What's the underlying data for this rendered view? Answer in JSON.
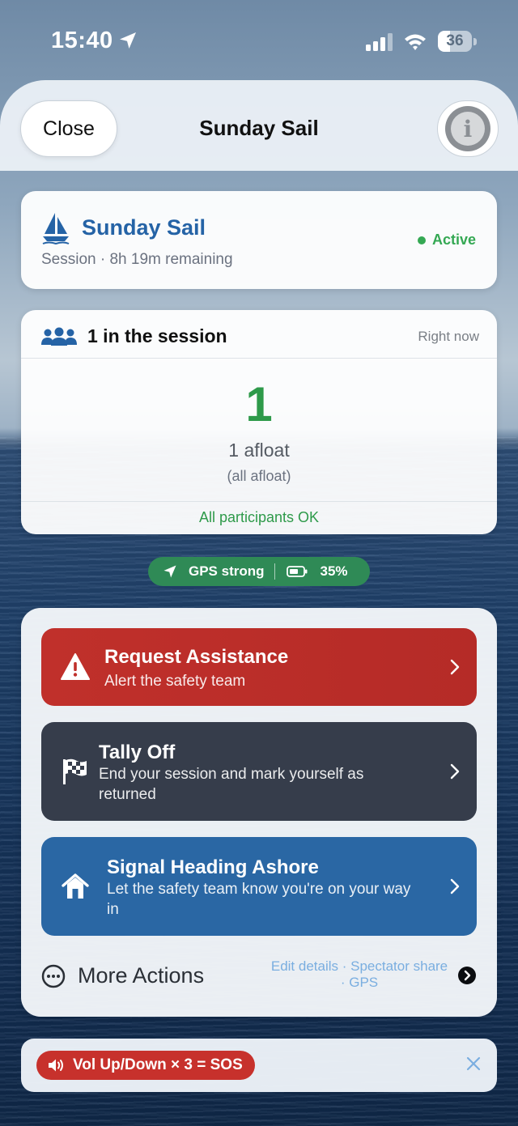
{
  "status_bar": {
    "time": "15:40",
    "battery_level": "36"
  },
  "header": {
    "close_label": "Close",
    "title": "Sunday Sail",
    "info_glyph": "i"
  },
  "session": {
    "name": "Sunday Sail",
    "subtitle": "Session · 8h 19m remaining",
    "status": "Active"
  },
  "participants": {
    "title": "1 in the session",
    "updated": "Right now",
    "count": "1",
    "afloat_label": "1 afloat",
    "afloat_sub": "(all afloat)",
    "status_ok": "All participants OK"
  },
  "gps": {
    "label": "GPS strong",
    "battery": "35%"
  },
  "actions": {
    "assist": {
      "title": "Request Assistance",
      "subtitle": "Alert the safety team",
      "icon": "warning-triangle-icon"
    },
    "tally": {
      "title": "Tally Off",
      "subtitle": "End your session and mark yourself as returned",
      "icon": "checkered-flag-icon"
    },
    "ashore": {
      "title": "Signal Heading Ashore",
      "subtitle": "Let the safety team know you're on your way in",
      "icon": "house-icon"
    },
    "more": {
      "label": "More Actions",
      "links": "Edit details · Spectator share · GPS"
    }
  },
  "sos": {
    "label": "Vol Up/Down × 3 = SOS"
  },
  "colors": {
    "accent_blue": "#2563a6",
    "ok_green": "#2e9a4a",
    "danger_red": "#c0302b",
    "tally_dark": "#363d4b",
    "ashore_blue": "#2a67a4"
  }
}
